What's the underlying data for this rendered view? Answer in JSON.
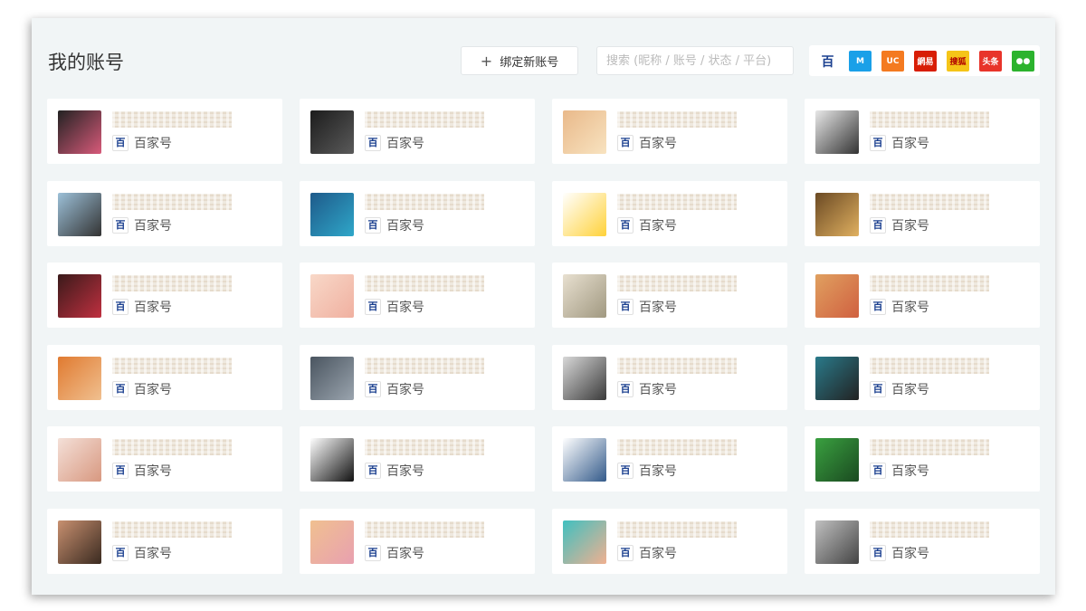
{
  "header": {
    "title": "我的账号",
    "bind_button": "绑定新账号",
    "search_placeholder": "搜索 (昵称 / 账号 / 状态 / 平台)"
  },
  "platform_filters": [
    {
      "name": "baijiahao-icon",
      "glyph": "百",
      "bg": "#ffffff",
      "fg": "#1a3f8f"
    },
    {
      "name": "dayu-icon",
      "glyph": "M",
      "bg": "#1aa0e8",
      "fg": "#ffffff"
    },
    {
      "name": "uc-icon",
      "glyph": "UC",
      "bg": "#f47a20",
      "fg": "#ffffff"
    },
    {
      "name": "netease-icon",
      "glyph": "網易",
      "bg": "#d81e06",
      "fg": "#ffffff"
    },
    {
      "name": "sohu-icon",
      "glyph": "搜狐",
      "bg": "#f5c518",
      "fg": "#b00000"
    },
    {
      "name": "toutiao-icon",
      "glyph": "头条",
      "bg": "#e8342a",
      "fg": "#ffffff"
    },
    {
      "name": "wechat-icon",
      "glyph": "●●",
      "bg": "#2cb32e",
      "fg": "#ffffff"
    }
  ],
  "accounts": [
    {
      "platform": "百家号",
      "avatar": [
        "#222222",
        "#d85a7a"
      ]
    },
    {
      "platform": "百家号",
      "avatar": [
        "#1c1c1c",
        "#5a5a5a"
      ]
    },
    {
      "platform": "百家号",
      "avatar": [
        "#e9b98a",
        "#f8e3c0"
      ]
    },
    {
      "platform": "百家号",
      "avatar": [
        "#e8e8e8",
        "#333333"
      ]
    },
    {
      "platform": "百家号",
      "avatar": [
        "#9cc0d8",
        "#333333"
      ]
    },
    {
      "platform": "百家号",
      "avatar": [
        "#1e5a8a",
        "#2fa7c9"
      ]
    },
    {
      "platform": "百家号",
      "avatar": [
        "#ffffff",
        "#ffd23a"
      ]
    },
    {
      "platform": "百家号",
      "avatar": [
        "#6b4a24",
        "#e0b060"
      ]
    },
    {
      "platform": "百家号",
      "avatar": [
        "#3a1a1a",
        "#c03040"
      ]
    },
    {
      "platform": "百家号",
      "avatar": [
        "#f8d8c8",
        "#f0b0a0"
      ]
    },
    {
      "platform": "百家号",
      "avatar": [
        "#e8e0d0",
        "#a09880"
      ]
    },
    {
      "platform": "百家号",
      "avatar": [
        "#e0a060",
        "#d06040"
      ]
    },
    {
      "platform": "百家号",
      "avatar": [
        "#e07a30",
        "#f0c090"
      ]
    },
    {
      "platform": "百家号",
      "avatar": [
        "#4a5560",
        "#9aa4ae"
      ]
    },
    {
      "platform": "百家号",
      "avatar": [
        "#d8d8d8",
        "#3a3a3a"
      ]
    },
    {
      "platform": "百家号",
      "avatar": [
        "#2a7a8a",
        "#222222"
      ]
    },
    {
      "platform": "百家号",
      "avatar": [
        "#f4e0d8",
        "#d89880"
      ]
    },
    {
      "platform": "百家号",
      "avatar": [
        "#ffffff",
        "#111111"
      ]
    },
    {
      "platform": "百家号",
      "avatar": [
        "#ffffff",
        "#335a8a"
      ]
    },
    {
      "platform": "百家号",
      "avatar": [
        "#3aa040",
        "#1a4a20"
      ]
    },
    {
      "platform": "百家号",
      "avatar": [
        "#c89070",
        "#3a2a20"
      ]
    },
    {
      "platform": "百家号",
      "avatar": [
        "#f0c090",
        "#e8a0b0"
      ]
    },
    {
      "platform": "百家号",
      "avatar": [
        "#40c0c0",
        "#f0b090"
      ]
    },
    {
      "platform": "百家号",
      "avatar": [
        "#c0c0c0",
        "#444444"
      ]
    }
  ]
}
